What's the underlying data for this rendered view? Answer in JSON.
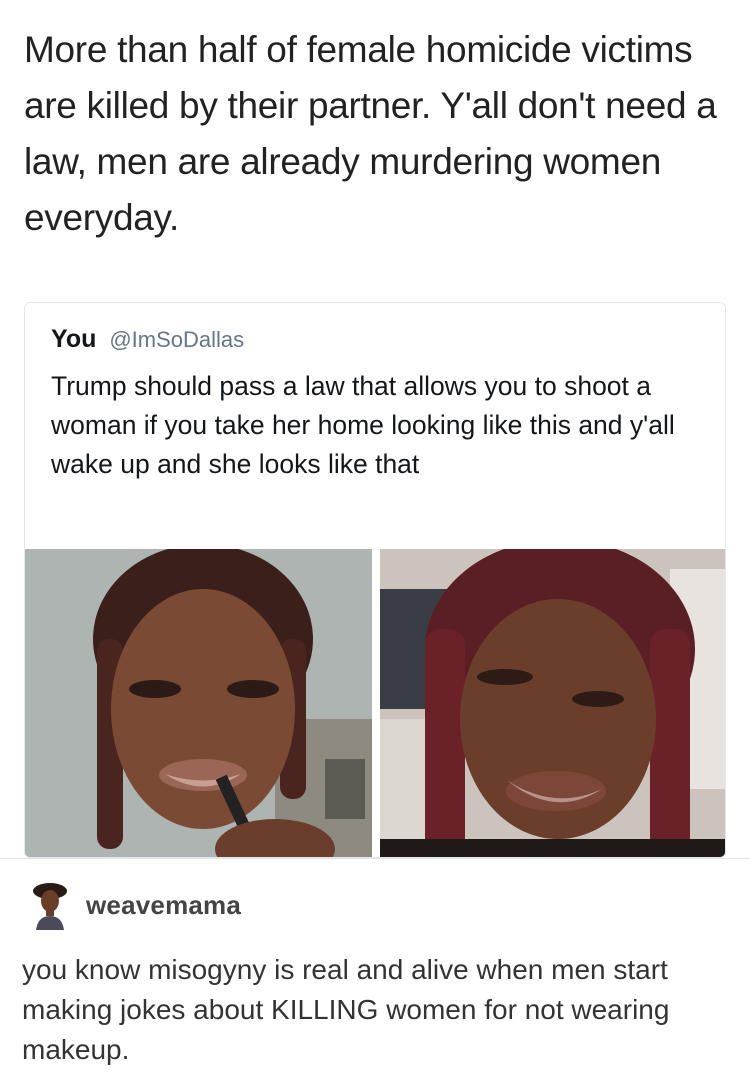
{
  "post": {
    "text": "More than half of female homicide victims are killed by their partner. Y'all don't need a law, men are already murdering women everyday."
  },
  "quoted_tweet": {
    "name": "You",
    "handle": "@ImSoDallas",
    "text": "Trump should pass a law that allows you to shoot a woman if you take her home looking like this and y'all wake up and she looks like that"
  },
  "reply": {
    "username": "weavemama",
    "text": "you know misogyny is real and alive when men start making jokes about KILLING women for not wearing makeup."
  },
  "colors": {
    "card_border": "#e1e8ed",
    "handle": "#657786",
    "text": "#14171a"
  }
}
